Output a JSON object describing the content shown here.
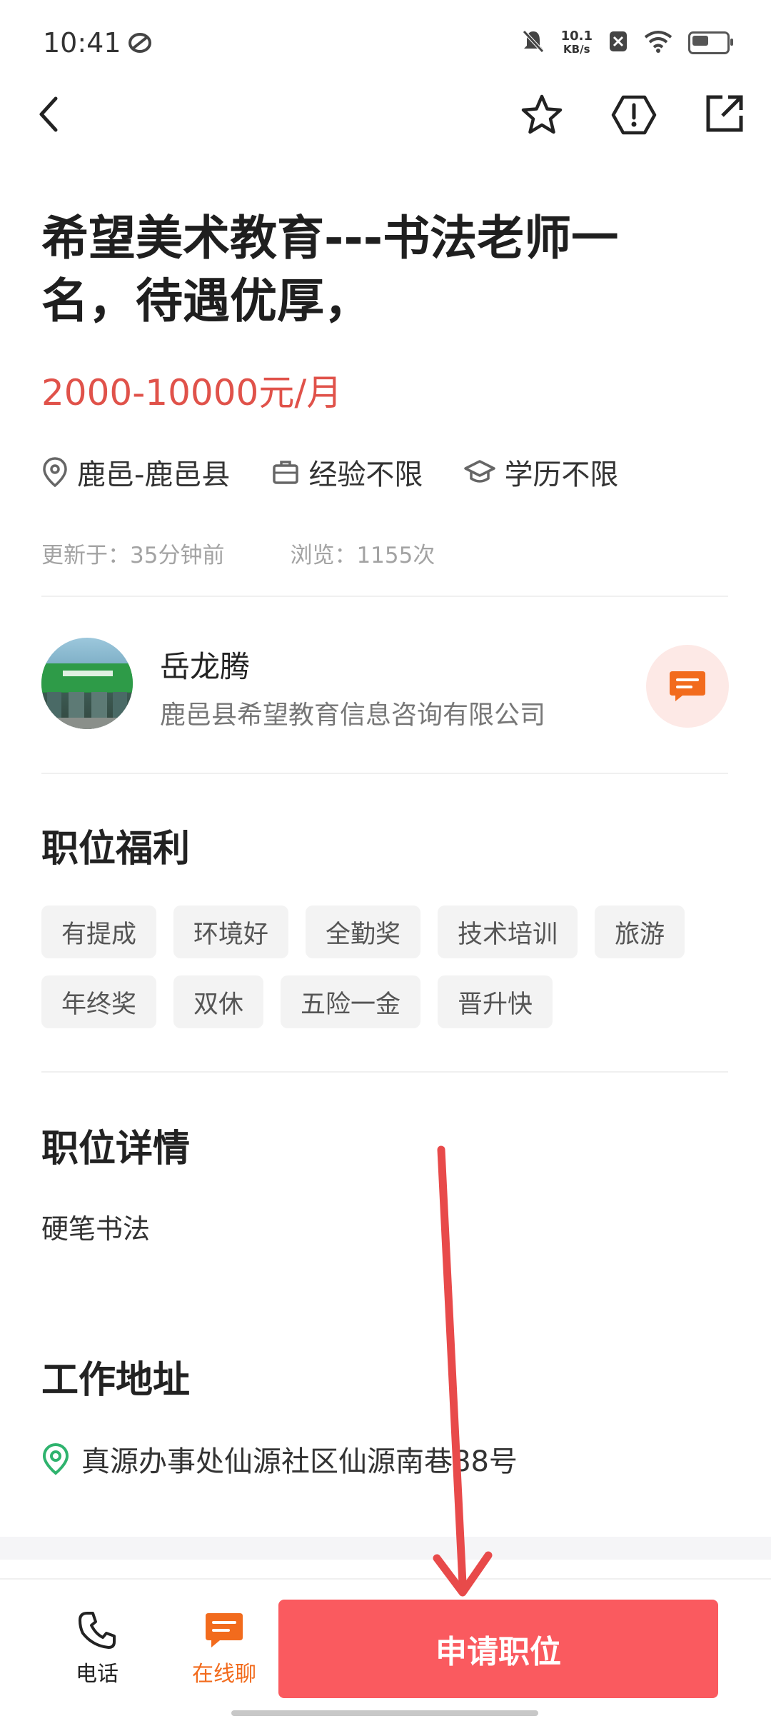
{
  "status_bar": {
    "time": "10:41",
    "net_speed_value": "10.1",
    "net_speed_unit": "KB/s"
  },
  "nav": {
    "icons": [
      "back-icon",
      "star-icon",
      "report-icon",
      "share-icon"
    ]
  },
  "job": {
    "title": "希望美术教育---书法老师一名，待遇优厚，",
    "salary": "2000-10000元/月",
    "location": "鹿邑-鹿邑县",
    "experience": "经验不限",
    "education": "学历不限",
    "updated": "更新于：35分钟前",
    "views": "浏览：1155次"
  },
  "recruiter": {
    "name": "岳龙腾",
    "company": "鹿邑县希望教育信息咨询有限公司"
  },
  "benefits": {
    "title": "职位福利",
    "tags": [
      "有提成",
      "环境好",
      "全勤奖",
      "技术培训",
      "旅游",
      "年终奖",
      "双休",
      "五险一金",
      "晋升快"
    ]
  },
  "details": {
    "title": "职位详情",
    "text": "硬笔书法"
  },
  "address": {
    "title": "工作地址",
    "text": "真源办事处仙源社区仙源南巷88号"
  },
  "bottom_bar": {
    "phone_label": "电话",
    "chat_label": "在线聊",
    "apply_label": "申请职位"
  },
  "colors": {
    "accent": "#fa5a5f",
    "salary": "#e0524a",
    "chat_orange": "#f26b1d",
    "location_green": "#2fb36e"
  }
}
